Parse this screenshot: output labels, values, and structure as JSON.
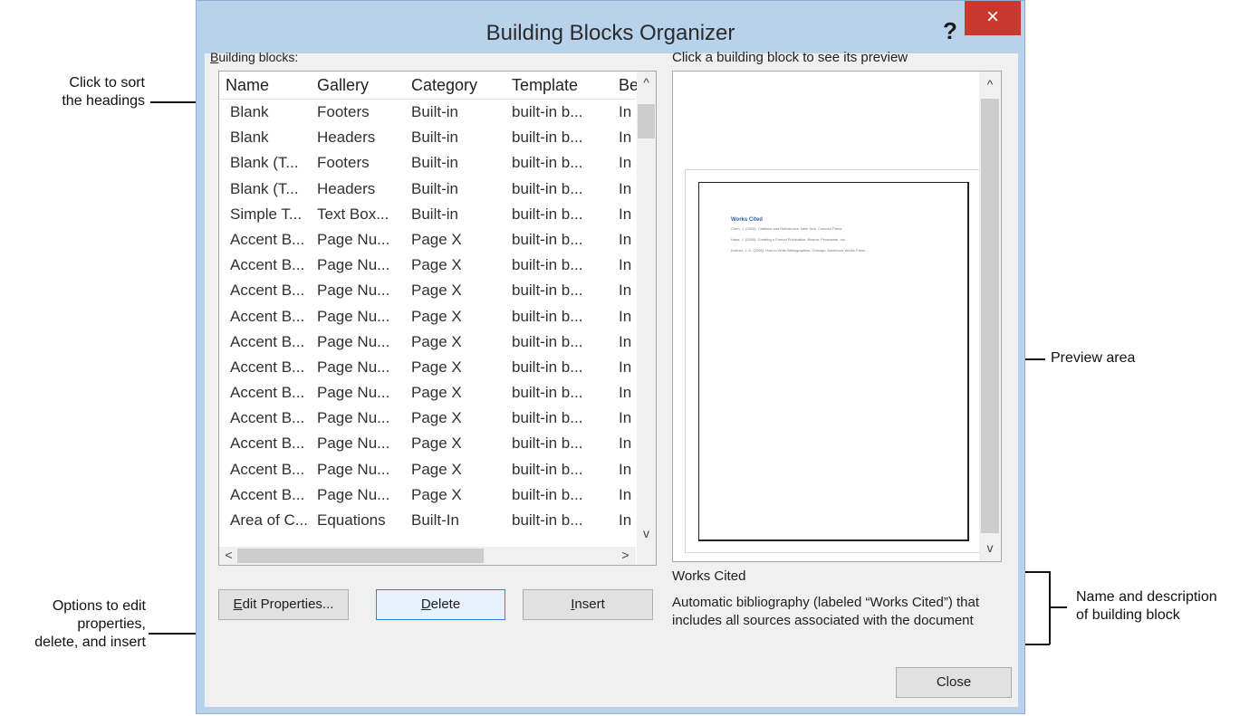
{
  "dialog": {
    "title": "Building Blocks Organizer",
    "help_label": "?",
    "close_x_label": "×"
  },
  "list": {
    "label_accel": "B",
    "label_rest": "uilding blocks:",
    "columns": [
      "Name",
      "Gallery",
      "Category",
      "Template",
      "Be"
    ],
    "rows": [
      [
        "Blank",
        "Footers",
        "Built-in",
        "built-in b...",
        "In"
      ],
      [
        "Blank",
        "Headers",
        "Built-in",
        "built-in b...",
        "In"
      ],
      [
        "Blank (T...",
        "Footers",
        "Built-in",
        "built-in b...",
        "In"
      ],
      [
        "Blank (T...",
        "Headers",
        "Built-in",
        "built-in b...",
        "In"
      ],
      [
        "Simple T...",
        "Text Box...",
        "Built-in",
        "built-in b...",
        "In"
      ],
      [
        "Accent B...",
        "Page Nu...",
        "Page X",
        "built-in b...",
        "In"
      ],
      [
        "Accent B...",
        "Page Nu...",
        "Page X",
        "built-in b...",
        "In"
      ],
      [
        "Accent B...",
        "Page Nu...",
        "Page X",
        "built-in b...",
        "In"
      ],
      [
        "Accent B...",
        "Page Nu...",
        "Page X",
        "built-in b...",
        "In"
      ],
      [
        "Accent B...",
        "Page Nu...",
        "Page X",
        "built-in b...",
        "In"
      ],
      [
        "Accent B...",
        "Page Nu...",
        "Page X",
        "built-in b...",
        "In"
      ],
      [
        "Accent B...",
        "Page Nu...",
        "Page X",
        "built-in b...",
        "In"
      ],
      [
        "Accent B...",
        "Page Nu...",
        "Page X",
        "built-in b...",
        "In"
      ],
      [
        "Accent B...",
        "Page Nu...",
        "Page X",
        "built-in b...",
        "In"
      ],
      [
        "Accent B...",
        "Page Nu...",
        "Page X",
        "built-in b...",
        "In"
      ],
      [
        "Accent B...",
        "Page Nu...",
        "Page X",
        "built-in b...",
        "In"
      ],
      [
        "Area of C...",
        "Equations",
        "Built-In",
        "built-in b...",
        "In"
      ]
    ]
  },
  "buttons": {
    "edit_accel": "E",
    "edit_rest": "dit Properties...",
    "delete_accel": "D",
    "delete_rest": "elete",
    "insert_accel": "I",
    "insert_rest": "nsert",
    "close": "Close"
  },
  "preview": {
    "label": "Click a building block to see its preview",
    "doc_title": "Works Cited",
    "doc_lines": [
      "Chen, J. (2003). Citations and References. New York: Contoso Press.",
      "Haas, J. (2005). Creating a Formal Publication. Boston: Proseware, Inc.",
      "Kramer, J. D. (2006). How to Write Bibliographies. Chicago: Adventure Works Press."
    ]
  },
  "description": {
    "name": "Works Cited",
    "text": "Automatic bibliography (labeled “Works Cited”) that includes all sources associated with the document"
  },
  "callouts": {
    "sort_line1": "Click to sort",
    "sort_line2": "the headings",
    "options_line1": "Options to edit",
    "options_line2": "properties,",
    "options_line3": "delete, and insert",
    "preview": "Preview area",
    "name_line1": "Name and description",
    "name_line2": "of building block"
  },
  "icons": {
    "scroll_up": "^",
    "scroll_down": "v",
    "scroll_left": "<",
    "scroll_right": ">"
  },
  "colors": {
    "frame": "#b9d2ec",
    "close_button": "#c8382c",
    "face": "#f0f0f0",
    "doc_title": "#2e5ea8"
  }
}
